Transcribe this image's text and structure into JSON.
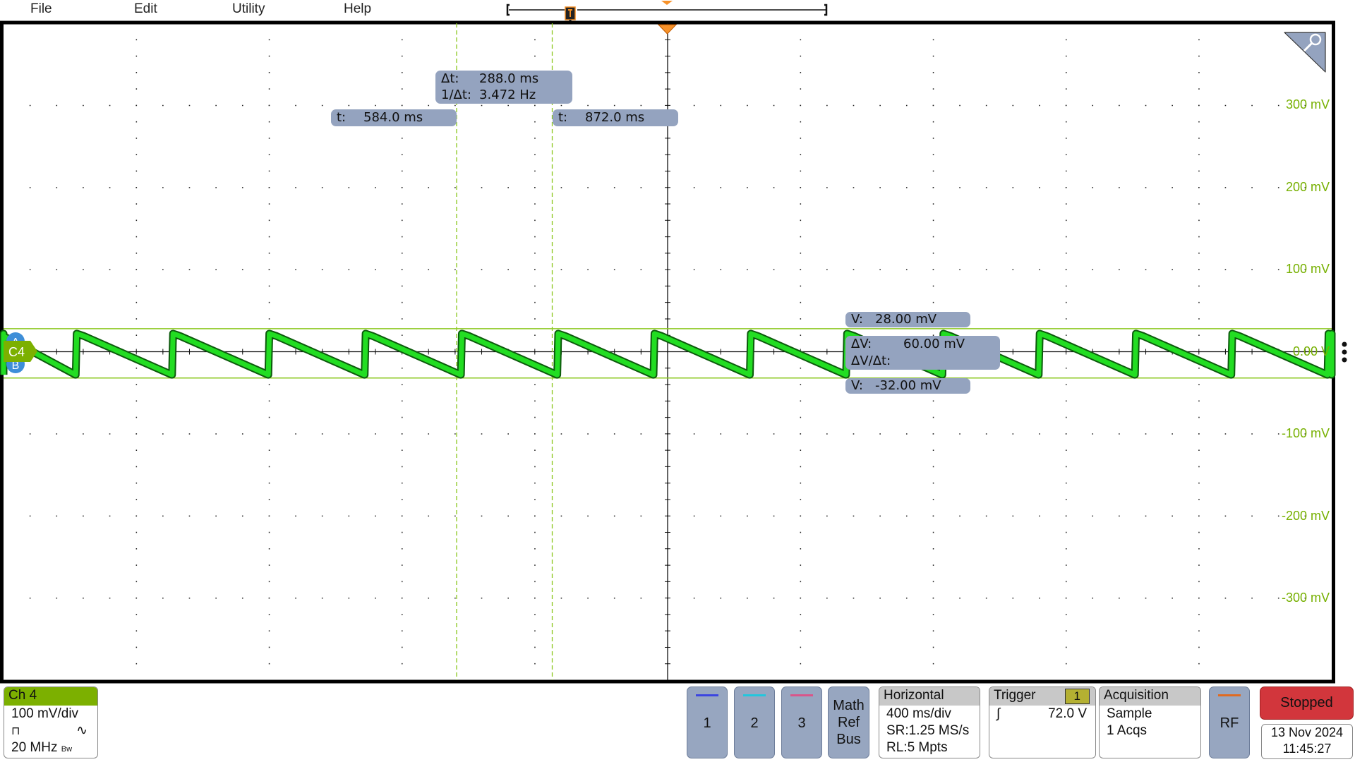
{
  "menu": [
    "File",
    "Edit",
    "Utility",
    "Help"
  ],
  "cursors": {
    "delta_t": {
      "label": "Δt:",
      "value": "288.0 ms"
    },
    "inv_delta_t": {
      "label": "1/Δt:",
      "value": "3.472 Hz"
    },
    "t1": {
      "label": "t:",
      "value": "584.0 ms"
    },
    "t2": {
      "label": "t:",
      "value": "872.0 ms"
    },
    "v1": {
      "label": "V:",
      "value": "28.00 mV"
    },
    "delta_v": {
      "label": "ΔV:",
      "value": "60.00 mV"
    },
    "dv_dt": {
      "label": "ΔV/Δt:",
      "value": ""
    },
    "v2": {
      "label": "V:",
      "value": "-32.00 mV"
    }
  },
  "y_axis_labels": [
    "300 mV",
    "200 mV",
    "100 mV",
    "0.00 V",
    "-100 mV",
    "-200 mV",
    "-300 mV"
  ],
  "channel_marker": "C4",
  "ab_marker": {
    "a": "A",
    "b": "B"
  },
  "waveform": {
    "channel": "Ch 4",
    "color": "#22dd22",
    "period_ms": 290,
    "first_rise_ms": -563,
    "low_mv": -28,
    "high_mv": 22,
    "time_per_div_ms": 400,
    "mv_per_div": 100
  },
  "ch4": {
    "title": "Ch 4",
    "scale": "100 mV/div",
    "bandwidth": "20 MHz",
    "bw_mark": "Bw",
    "color": "#7cb000"
  },
  "channel_buttons": [
    {
      "label": "1",
      "color": "#3b45e0"
    },
    {
      "label": "2",
      "color": "#22c6dd"
    },
    {
      "label": "3",
      "color": "#d9558a"
    }
  ],
  "math_ref_bus": [
    "Math",
    "Ref",
    "Bus"
  ],
  "horizontal": {
    "title": "Horizontal",
    "scale": "400 ms/div",
    "sr": "SR:1.25 MS/s",
    "rl": "RL:5 Mpts"
  },
  "trigger": {
    "title": "Trigger",
    "source": "1",
    "level": "72.0 V"
  },
  "acquisition": {
    "title": "Acquisition",
    "mode": "Sample",
    "count": "1 Acqs"
  },
  "rf": {
    "label": "RF",
    "color": "#e06a20"
  },
  "status": {
    "label": "Stopped",
    "color": "#d2363c"
  },
  "datetime": {
    "date": "13 Nov 2024",
    "time": "11:45:27"
  }
}
